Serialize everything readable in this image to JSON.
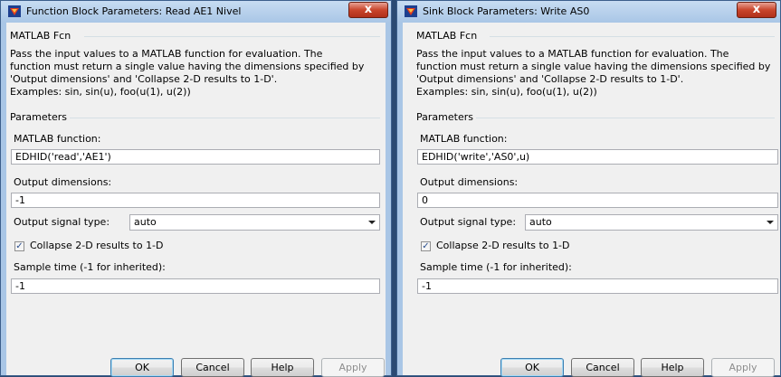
{
  "dialogs": [
    {
      "title": "Function Block Parameters: Read AE1 Nivel",
      "close_label": "x",
      "section_title": "MATLAB Fcn",
      "description": [
        "Pass the input values to a MATLAB function for evaluation.  The",
        "function must return a single value having the dimensions specified by",
        "'Output dimensions' and 'Collapse 2-D results to 1-D'.",
        "Examples: sin, sin(u), foo(u(1), u(2))"
      ],
      "parameters_title": "Parameters",
      "function_label": "MATLAB function:",
      "function_value": "EDHID('read','AE1')",
      "output_dims_label": "Output dimensions:",
      "output_dims_value": "-1",
      "signal_type_label": "Output signal type:",
      "signal_type_value": "auto",
      "collapse_label": "Collapse 2-D results to 1-D",
      "collapse_checked": true,
      "sample_time_label": "Sample time (-1 for inherited):",
      "sample_time_value": "-1",
      "buttons": {
        "ok": "OK",
        "cancel": "Cancel",
        "help": "Help",
        "apply": "Apply"
      }
    },
    {
      "title": "Sink Block Parameters: Write AS0",
      "close_label": "x",
      "section_title": "MATLAB Fcn",
      "description": [
        "Pass the input values to a MATLAB function for evaluation.  The",
        "function must return a single value having the dimensions specified by",
        "'Output dimensions' and 'Collapse 2-D results to 1-D'.",
        "Examples: sin, sin(u), foo(u(1), u(2))"
      ],
      "parameters_title": "Parameters",
      "function_label": "MATLAB function:",
      "function_value": "EDHID('write','AS0',u)",
      "output_dims_label": "Output dimensions:",
      "output_dims_value": "0",
      "signal_type_label": "Output signal type:",
      "signal_type_value": "auto",
      "collapse_label": "Collapse 2-D results to 1-D",
      "collapse_checked": true,
      "sample_time_label": "Sample time (-1 for inherited):",
      "sample_time_value": "-1",
      "buttons": {
        "ok": "OK",
        "cancel": "Cancel",
        "help": "Help",
        "apply": "Apply"
      }
    }
  ],
  "colors": {
    "frame": "#a9c6e6",
    "client": "#f0f0f0",
    "close": "#c9452c"
  }
}
